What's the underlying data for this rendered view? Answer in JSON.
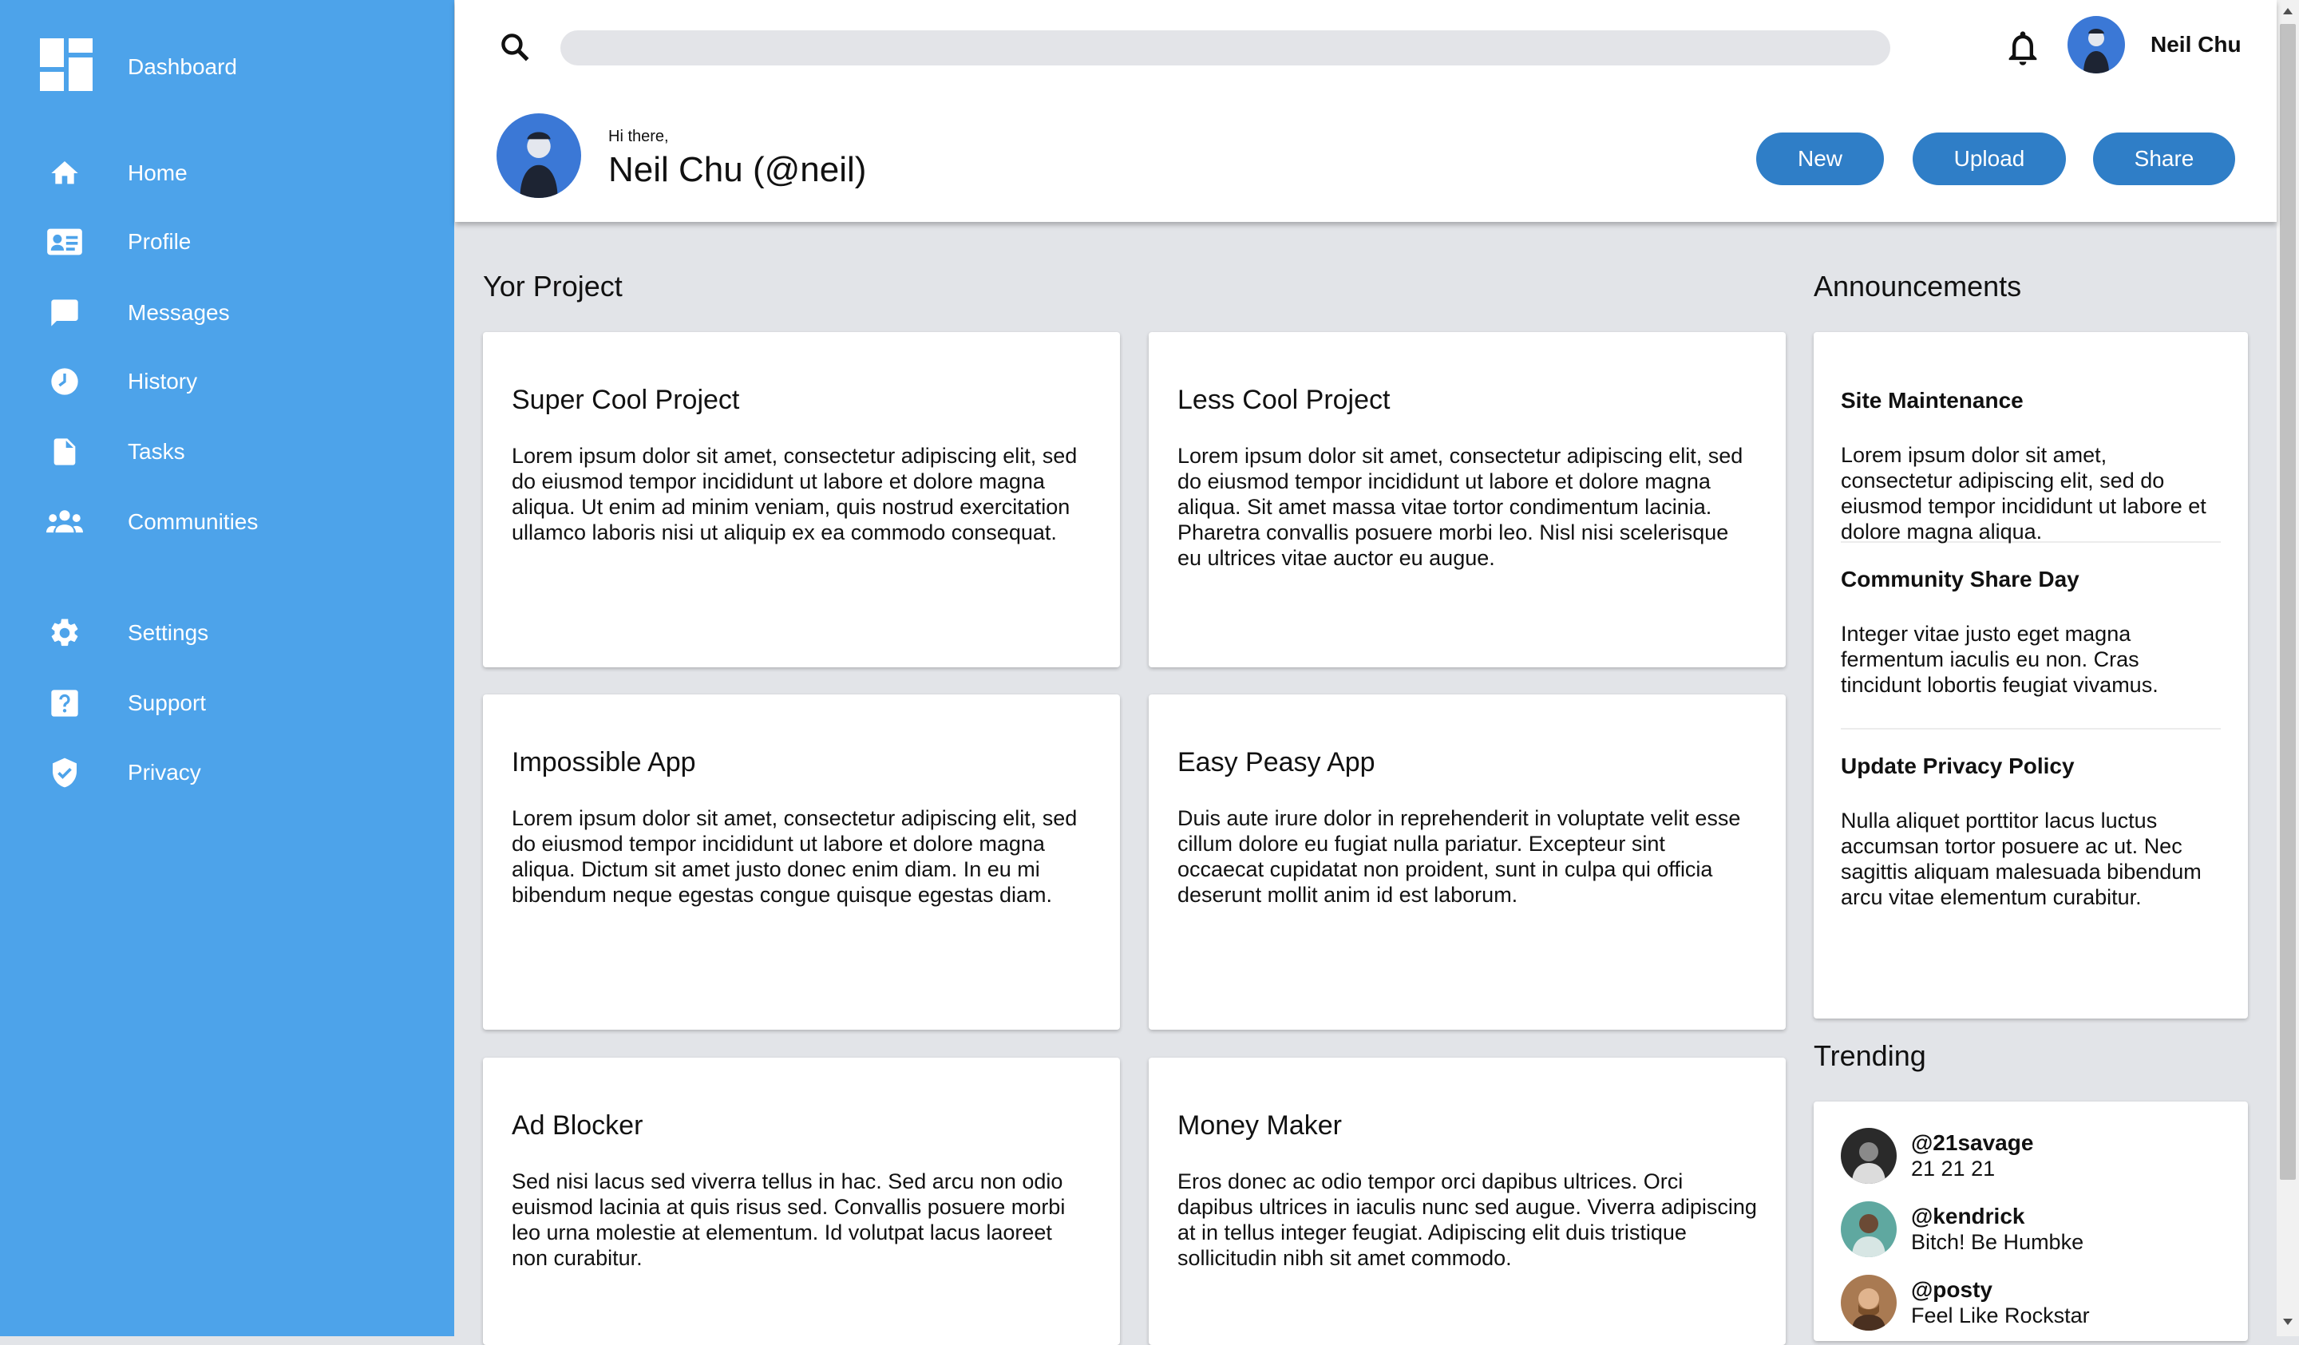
{
  "app": {
    "brand_label": "Dashboard",
    "accent_color": "#4da3ea",
    "button_color": "#2f7ec7"
  },
  "sidebar": {
    "items": [
      {
        "label": "Home",
        "icon": "home-icon"
      },
      {
        "label": "Profile",
        "icon": "id-card-icon"
      },
      {
        "label": "Messages",
        "icon": "chat-icon"
      },
      {
        "label": "History",
        "icon": "clock-icon"
      },
      {
        "label": "Tasks",
        "icon": "document-icon"
      },
      {
        "label": "Communities",
        "icon": "people-icon"
      },
      {
        "label": "Settings",
        "icon": "gear-icon"
      },
      {
        "label": "Support",
        "icon": "help-icon"
      },
      {
        "label": "Privacy",
        "icon": "shield-check-icon"
      }
    ]
  },
  "header": {
    "search_placeholder": "",
    "username": "Neil Chu",
    "greeting": "Hi there,",
    "display_name": "Neil Chu (@neil)",
    "buttons": {
      "new": "New",
      "upload": "Upload",
      "share": "Share"
    }
  },
  "projects": {
    "title": "Yor Project",
    "items": [
      {
        "title": "Super Cool Project",
        "description": "Lorem ipsum dolor sit amet, consectetur adipiscing elit, sed do eiusmod tempor incididunt ut labore et dolore magna aliqua. Ut enim ad minim veniam, quis nostrud exercitation ullamco laboris nisi ut aliquip ex ea commodo consequat."
      },
      {
        "title": "Less Cool Project",
        "description": "Lorem ipsum dolor sit amet, consectetur adipiscing elit, sed do eiusmod tempor incididunt ut labore et dolore magna aliqua. Sit amet massa vitae tortor condimentum lacinia. Pharetra convallis posuere morbi leo. Nisl nisi scelerisque eu ultrices vitae auctor eu augue."
      },
      {
        "title": "Impossible App",
        "description": "Lorem ipsum dolor sit amet, consectetur adipiscing elit, sed do eiusmod tempor incididunt ut labore et dolore magna aliqua. Dictum sit amet justo donec enim diam. In eu mi bibendum neque egestas congue quisque egestas diam."
      },
      {
        "title": "Easy Peasy App",
        "description": "Duis aute irure dolor in reprehenderit in voluptate velit esse cillum dolore eu fugiat nulla pariatur. Excepteur sint occaecat cupidatat non proident, sunt in culpa qui officia deserunt mollit anim id est laborum."
      },
      {
        "title": "Ad Blocker",
        "description": "Sed nisi lacus sed viverra tellus in hac. Sed arcu non odio euismod lacinia at quis risus sed. Convallis posuere morbi leo urna molestie at elementum. Id volutpat lacus laoreet non curabitur."
      },
      {
        "title": "Money Maker",
        "description": "Eros donec ac odio tempor orci dapibus ultrices. Orci dapibus ultrices in iaculis nunc sed augue. Viverra adipiscing at in tellus integer feugiat. Adipiscing elit duis tristique sollicitudin nibh sit amet commodo."
      }
    ]
  },
  "announcements": {
    "title": "Announcements",
    "items": [
      {
        "title": "Site Maintenance",
        "description": "Lorem ipsum dolor sit amet, consectetur adipiscing elit, sed do eiusmod tempor incididunt ut labore et dolore magna aliqua."
      },
      {
        "title": "Community Share Day",
        "description": "Integer vitae justo eget magna fermentum iaculis eu non. Cras tincidunt lobortis feugiat vivamus."
      },
      {
        "title": "Update Privacy Policy",
        "description": "Nulla aliquet porttitor lacus luctus accumsan tortor posuere ac ut. Nec sagittis aliquam malesuada bibendum arcu vitae elementum curabitur."
      }
    ]
  },
  "trending": {
    "title": "Trending",
    "items": [
      {
        "handle": "@21savage",
        "text": "21 21 21"
      },
      {
        "handle": "@kendrick",
        "text": "Bitch! Be Humbke"
      },
      {
        "handle": "@posty",
        "text": "Feel Like Rockstar"
      }
    ]
  }
}
